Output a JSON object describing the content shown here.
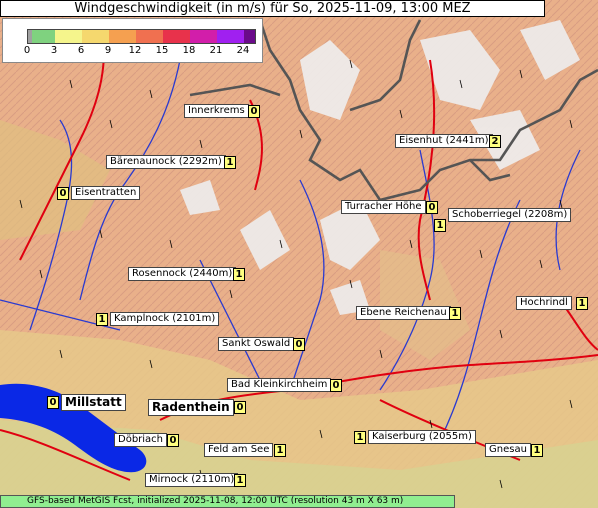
{
  "header": {
    "title": "Windgeschwindigkeit (in m/s) für So, 2025-11-09, 13:00 MEZ"
  },
  "legend": {
    "ticks": [
      "0",
      "3",
      "6",
      "9",
      "12",
      "15",
      "18",
      "21",
      "24"
    ],
    "colors": [
      "#a0a0a0",
      "#7fd27f",
      "#f5f58c",
      "#f5d86e",
      "#f5a050",
      "#f07050",
      "#e8324b",
      "#d21eaa",
      "#a020f0",
      "#6a0a8a"
    ]
  },
  "places": [
    {
      "name": "Innerkrems",
      "wind": "0"
    },
    {
      "name": "Bärenaunock (2292m)",
      "wind": "1"
    },
    {
      "name": "Eisentratten",
      "wind": "0"
    },
    {
      "name": "Eisenhut (2441m)",
      "wind": "2"
    },
    {
      "name": "Turracher Höhe",
      "wind": "0"
    },
    {
      "name": "Schoberriegel (2208m)",
      "wind": "1"
    },
    {
      "name": "Rosennock (2440m)",
      "wind": "1"
    },
    {
      "name": "Kamplnock (2101m)",
      "wind": "1"
    },
    {
      "name": "Ebene Reichenau",
      "wind": "1"
    },
    {
      "name": "Hochrindl",
      "wind": "1"
    },
    {
      "name": "Sankt Oswald",
      "wind": "0"
    },
    {
      "name": "Bad Kleinkirchheim",
      "wind": "0"
    },
    {
      "name": "Millstatt",
      "wind": "0"
    },
    {
      "name": "Radenthein",
      "wind": "0"
    },
    {
      "name": "Döbriach",
      "wind": "0"
    },
    {
      "name": "Feld am See",
      "wind": "1"
    },
    {
      "name": "Kaiserburg (2055m)",
      "wind": "1"
    },
    {
      "name": "Gnesau",
      "wind": "1"
    },
    {
      "name": "Mirnock (2110m)",
      "wind": "1"
    }
  ],
  "footer": {
    "text": "GFS-based MetGIS Fcst, initialized 2025-11-08, 12:00 UTC  (resolution 43 m X 63 m)"
  }
}
